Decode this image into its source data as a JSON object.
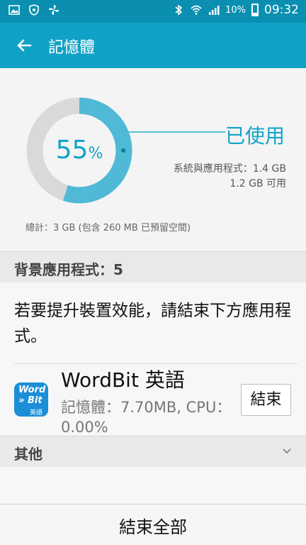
{
  "status_bar": {
    "battery_percent": "10%",
    "time": "09:32",
    "left_icons": [
      "image-icon",
      "shield-icon",
      "fan-icon"
    ],
    "right_icons": [
      "bluetooth-icon",
      "wifi-icon",
      "signal-icon",
      "battery-icon"
    ]
  },
  "app_bar": {
    "title": "記憶體",
    "back_icon": "arrow-left-icon"
  },
  "usage": {
    "percent_used": 55,
    "percent_number": "55",
    "percent_sign": "%",
    "used_label": "已使用",
    "system_apps": "系統與應用程式：1.4 GB",
    "available": "1.2 GB 可用",
    "total": "總計：3 GB (包含 260 MB 已預留空間)"
  },
  "background_apps": {
    "header": "背景應用程式：5",
    "description": "若要提升裝置效能，請結束下方應用程式。",
    "apps": [
      {
        "name": "WordBit 英語",
        "memory": "記憶體：7.70MB, CPU：0.00%",
        "end_label": "結束",
        "icon_text": [
          "Word",
          "» Bit",
          "英語"
        ]
      }
    ]
  },
  "other": {
    "header": "其他"
  },
  "end_all_label": "結束全部",
  "colors": {
    "accent": "#10a2c6",
    "donut_used": "#4fb9d6",
    "donut_free": "#d9d9d9",
    "statusbar": "#0a8fb0"
  }
}
